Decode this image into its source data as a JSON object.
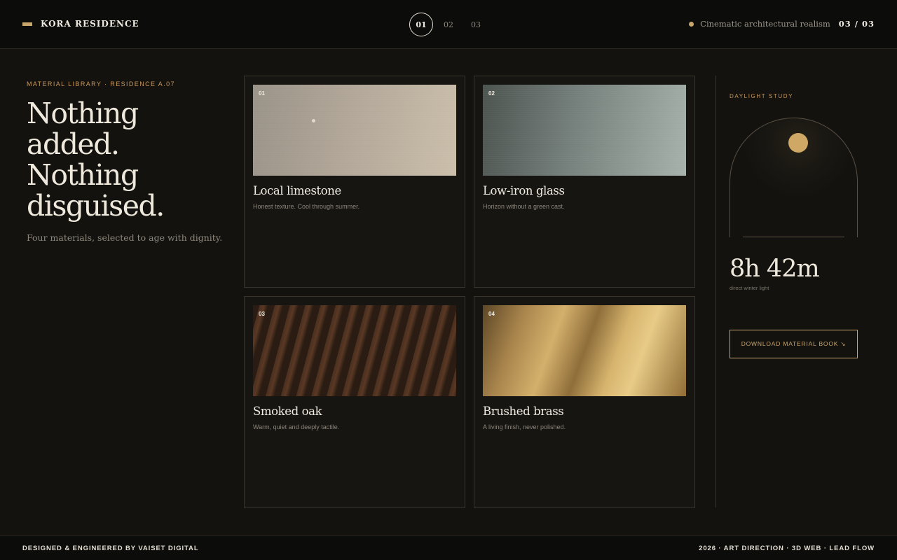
{
  "header": {
    "brand": "KORA RESIDENCE",
    "steps": [
      "01",
      "02",
      "03"
    ],
    "active_step": "01",
    "tagline": "Cinematic architectural realism",
    "counter": "03 / 03"
  },
  "intro": {
    "eyebrow": "MATERIAL LIBRARY · RESIDENCE A.07",
    "headline_lines": [
      "Nothing",
      "added.",
      "Nothing",
      "disguised."
    ],
    "subline": "Four materials, selected to age with dignity."
  },
  "materials": [
    {
      "number": "01",
      "title": "Local limestone",
      "description": "Honest texture. Cool through summer."
    },
    {
      "number": "02",
      "title": "Low-iron glass",
      "description": "Horizon without a green cast."
    },
    {
      "number": "03",
      "title": "Smoked oak",
      "description": "Warm, quiet and deeply tactile."
    },
    {
      "number": "04",
      "title": "Brushed brass",
      "description": "A living finish, never polished."
    }
  ],
  "daylight": {
    "label": "DAYLIGHT STUDY",
    "duration": "8h 42m",
    "caption": "direct winter light",
    "button": "DOWNLOAD MATERIAL BOOK ↘"
  },
  "footer": {
    "left": "DESIGNED & ENGINEERED BY VAISET DIGITAL",
    "right": "2026 · ART DIRECTION · 3D WEB · LEAD FLOW"
  },
  "colors": {
    "accent": "#c9a66b",
    "background": "#13120f",
    "text": "#efe9dd"
  }
}
